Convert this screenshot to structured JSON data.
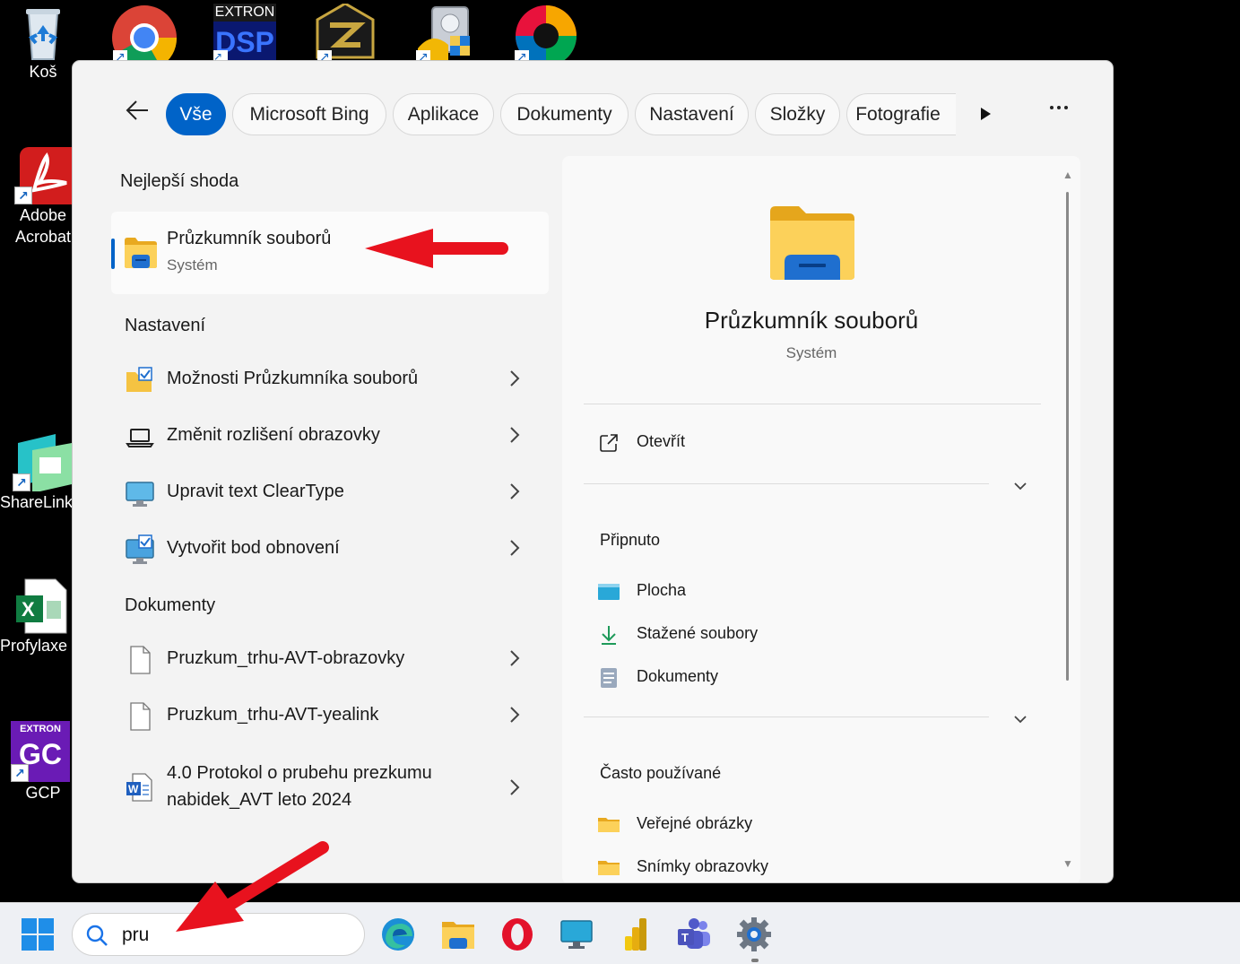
{
  "desktop": {
    "icons": [
      {
        "label": "Koš"
      },
      {
        "label": "Adobe Acrobat"
      },
      {
        "label": "ShareLink P"
      },
      {
        "label": "Profylaxe ("
      },
      {
        "label": "GCP"
      }
    ],
    "top_icons_text": {
      "extron": "EXTRON",
      "dsp": "DSP",
      "extron2": "EXTRON",
      "gc": "GC"
    }
  },
  "search": {
    "filters": [
      {
        "label": "Vše",
        "active": true
      },
      {
        "label": "Microsoft Bing"
      },
      {
        "label": "Aplikace"
      },
      {
        "label": "Dokumenty"
      },
      {
        "label": "Nastavení"
      },
      {
        "label": "Složky"
      },
      {
        "label": "Fotografie"
      }
    ],
    "best_match": {
      "section": "Nejlepší shoda",
      "title": "Průzkumník souborů",
      "subtitle": "Systém"
    },
    "settings": {
      "section": "Nastavení",
      "items": [
        {
          "label": "Možnosti Průzkumníka souborů",
          "icon": "folder-options-icon"
        },
        {
          "label": "Změnit rozlišení obrazovky",
          "icon": "laptop-icon"
        },
        {
          "label": "Upravit text ClearType",
          "icon": "monitor-icon"
        },
        {
          "label": "Vytvořit bod obnovení",
          "icon": "restore-point-icon"
        }
      ]
    },
    "documents": {
      "section": "Dokumenty",
      "items": [
        {
          "label": "Pruzkum_trhu-AVT-obrazovky",
          "icon": "file-icon"
        },
        {
          "label": "Pruzkum_trhu-AVT-yealink",
          "icon": "file-icon"
        },
        {
          "label": "4.0 Protokol o prubehu prezkumu nabidek_AVT leto 2024",
          "icon": "word-doc-icon"
        }
      ]
    }
  },
  "preview": {
    "title": "Průzkumník souborů",
    "subtitle": "Systém",
    "open_label": "Otevřít",
    "pinned": {
      "heading": "Připnuto",
      "items": [
        {
          "label": "Plocha",
          "icon": "desktop-folder-icon"
        },
        {
          "label": "Stažené soubory",
          "icon": "download-icon"
        },
        {
          "label": "Dokumenty",
          "icon": "documents-icon"
        }
      ]
    },
    "frequent": {
      "heading": "Často používané",
      "items": [
        {
          "label": "Veřejné obrázky",
          "icon": "folder-icon"
        },
        {
          "label": "Snímky obrazovky",
          "icon": "folder-icon"
        }
      ]
    }
  },
  "taskbar": {
    "search_value": "pru"
  },
  "colors": {
    "accent": "#0063c8",
    "annotation": "#e8121e",
    "folder": "#f5c342"
  }
}
